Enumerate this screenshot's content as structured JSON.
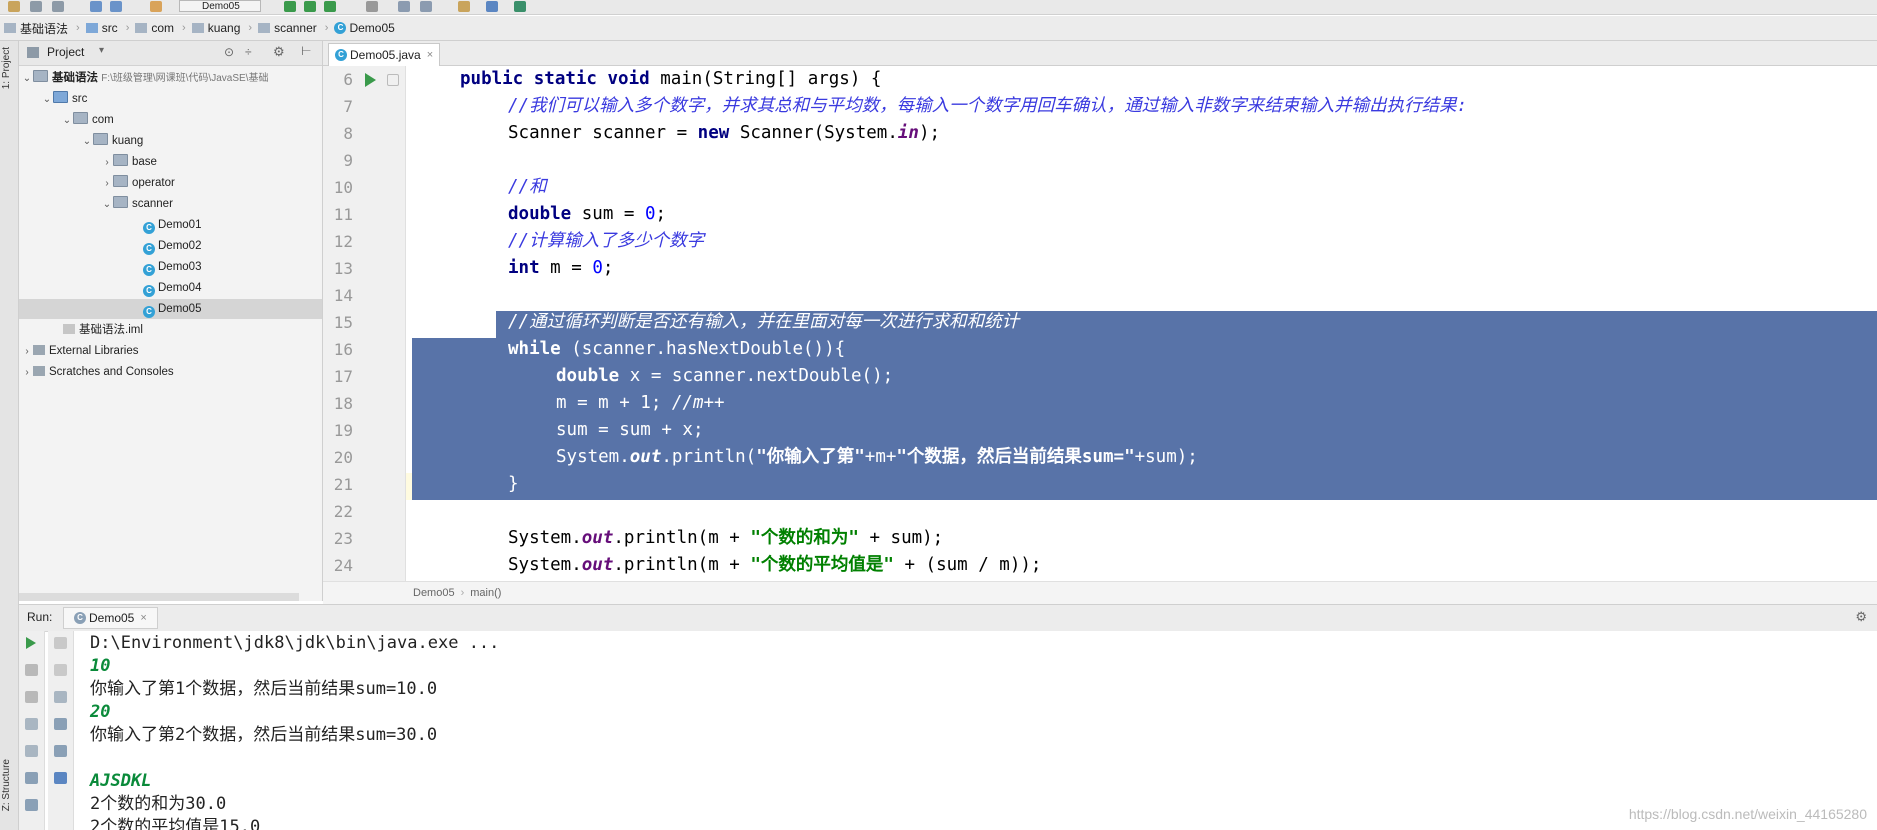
{
  "toolbar": {
    "run_config": "Demo05"
  },
  "breadcrumb": [
    "基础语法",
    "src",
    "com",
    "kuang",
    "scanner",
    "Demo05"
  ],
  "stripe": {
    "project": "1: Project",
    "structure": "Z: Structure"
  },
  "project_panel": {
    "title": "Project",
    "root": "基础语法",
    "root_path": "F:\\班级管理\\网课班\\代码\\JavaSE\\基础",
    "src": "src",
    "com": "com",
    "kuang": "kuang",
    "packages": [
      "base",
      "operator",
      "scanner"
    ],
    "classes": [
      "Demo01",
      "Demo02",
      "Demo03",
      "Demo04",
      "Demo05"
    ],
    "iml": "基础语法.iml",
    "ext_libs": "External Libraries",
    "scratches": "Scratches and Consoles"
  },
  "editor": {
    "tab": "Demo05.java",
    "line_numbers": [
      "6",
      "7",
      "8",
      "9",
      "10",
      "11",
      "12",
      "13",
      "14",
      "15",
      "16",
      "17",
      "18",
      "19",
      "20",
      "21",
      "22",
      "23",
      "24"
    ],
    "crumb_class": "Demo05",
    "crumb_method": "main()"
  },
  "run": {
    "label": "Run:",
    "tab": "Demo05",
    "lines": [
      "D:\\Environment\\jdk8\\jdk\\bin\\java.exe ...",
      "10",
      "你输入了第1个数据，然后当前结果sum=10.0",
      "20",
      "你输入了第2个数据，然后当前结果sum=30.0",
      "",
      "AJSDKL",
      "2个数的和为30.0",
      "2个数的平均值是15.0"
    ]
  },
  "watermark": "https://blog.csdn.net/weixin_44165280"
}
